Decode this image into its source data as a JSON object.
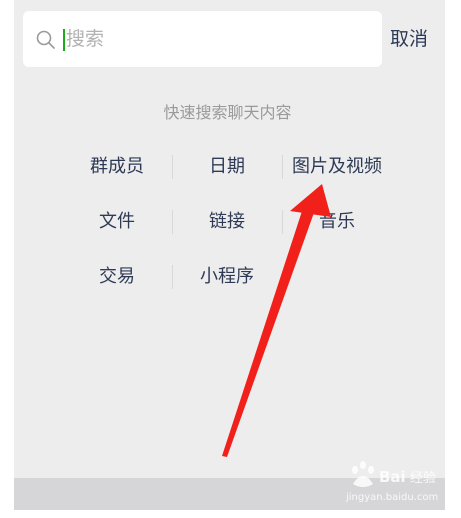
{
  "search": {
    "placeholder": "搜索",
    "cancel_label": "取消"
  },
  "hint": "快速搜索聊天内容",
  "categories": [
    [
      "群成员",
      "日期",
      "图片及视频"
    ],
    [
      "文件",
      "链接",
      "音乐"
    ],
    [
      "交易",
      "小程序"
    ]
  ],
  "colors": {
    "panel_bg": "#ededed",
    "link_text": "#2e3a55",
    "hint_text": "#9a9a9a",
    "cursor": "#1aad19",
    "annotation_arrow": "#f2201a"
  },
  "watermark": {
    "text": "Baidu经验",
    "subtext": "jingyan.baidu.com"
  }
}
